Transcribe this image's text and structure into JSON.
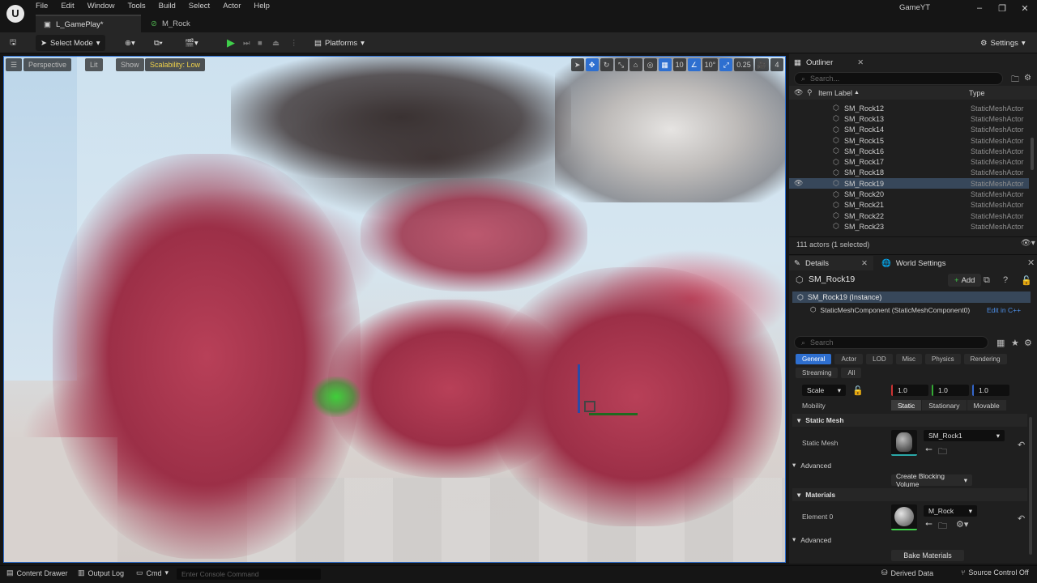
{
  "menubar": [
    "File",
    "Edit",
    "Window",
    "Tools",
    "Build",
    "Select",
    "Actor",
    "Help"
  ],
  "project_name": "GameYT",
  "tabs": [
    {
      "label": "L_GamePlay*"
    },
    {
      "label": "M_Rock"
    }
  ],
  "toolbar": {
    "select_mode": "Select Mode",
    "platforms": "Platforms",
    "settings": "Settings"
  },
  "viewport": {
    "perspective": "Perspective",
    "lit": "Lit",
    "show": "Show",
    "scalability": "Scalability: Low",
    "grid_snap": "10",
    "rot_snap": "10°",
    "scale_snap": "0.25",
    "cam_speed": "4"
  },
  "outliner": {
    "title": "Outliner",
    "search_placeholder": "Search...",
    "col_label": "Item Label",
    "col_type": "Type",
    "rows": [
      {
        "name": "SM_Rock12",
        "type": "StaticMeshActor"
      },
      {
        "name": "SM_Rock13",
        "type": "StaticMeshActor"
      },
      {
        "name": "SM_Rock14",
        "type": "StaticMeshActor"
      },
      {
        "name": "SM_Rock15",
        "type": "StaticMeshActor"
      },
      {
        "name": "SM_Rock16",
        "type": "StaticMeshActor"
      },
      {
        "name": "SM_Rock17",
        "type": "StaticMeshActor"
      },
      {
        "name": "SM_Rock18",
        "type": "StaticMeshActor"
      },
      {
        "name": "SM_Rock19",
        "type": "StaticMeshActor"
      },
      {
        "name": "SM_Rock20",
        "type": "StaticMeshActor"
      },
      {
        "name": "SM_Rock21",
        "type": "StaticMeshActor"
      },
      {
        "name": "SM_Rock22",
        "type": "StaticMeshActor"
      },
      {
        "name": "SM_Rock23",
        "type": "StaticMeshActor"
      }
    ],
    "selected_index": 7,
    "actor_count": "111 actors (1 selected)"
  },
  "details": {
    "tab": "Details",
    "world_settings_tab": "World Settings",
    "actor_name": "SM_Rock19",
    "add_label": "Add",
    "instance_label": "SM_Rock19 (Instance)",
    "component_label": "StaticMeshComponent (StaticMeshComponent0)",
    "edit_cpp": "Edit in C++",
    "search_placeholder": "Search",
    "filter_tabs": [
      "General",
      "Actor",
      "LOD",
      "Misc",
      "Physics",
      "Rendering",
      "Streaming",
      "All"
    ],
    "active_filter": "General",
    "scale_label": "Scale",
    "scale_values": [
      "1.0",
      "1.0",
      "1.0"
    ],
    "mobility_label": "Mobility",
    "mobility_options": [
      "Static",
      "Stationary",
      "Movable"
    ],
    "mobility_selected": "Static",
    "static_mesh_section": "Static Mesh",
    "static_mesh_label": "Static Mesh",
    "static_mesh_value": "SM_Rock1",
    "advanced_1": "Advanced",
    "create_blocking_volume": "Create Blocking Volume",
    "materials_section": "Materials",
    "element_label": "Element 0",
    "material_value": "M_Rock",
    "advanced_2": "Advanced",
    "bake_materials": "Bake Materials"
  },
  "statusbar": {
    "content_drawer": "Content Drawer",
    "output_log": "Output Log",
    "cmd": "Cmd",
    "console_placeholder": "Enter Console Command",
    "derived_data": "Derived Data",
    "source_control": "Source Control Off"
  },
  "colors": {
    "accent": "#2e6fd0",
    "play": "#3fcf4a",
    "scalability": "#f0d24a",
    "selection": "#37475a"
  }
}
